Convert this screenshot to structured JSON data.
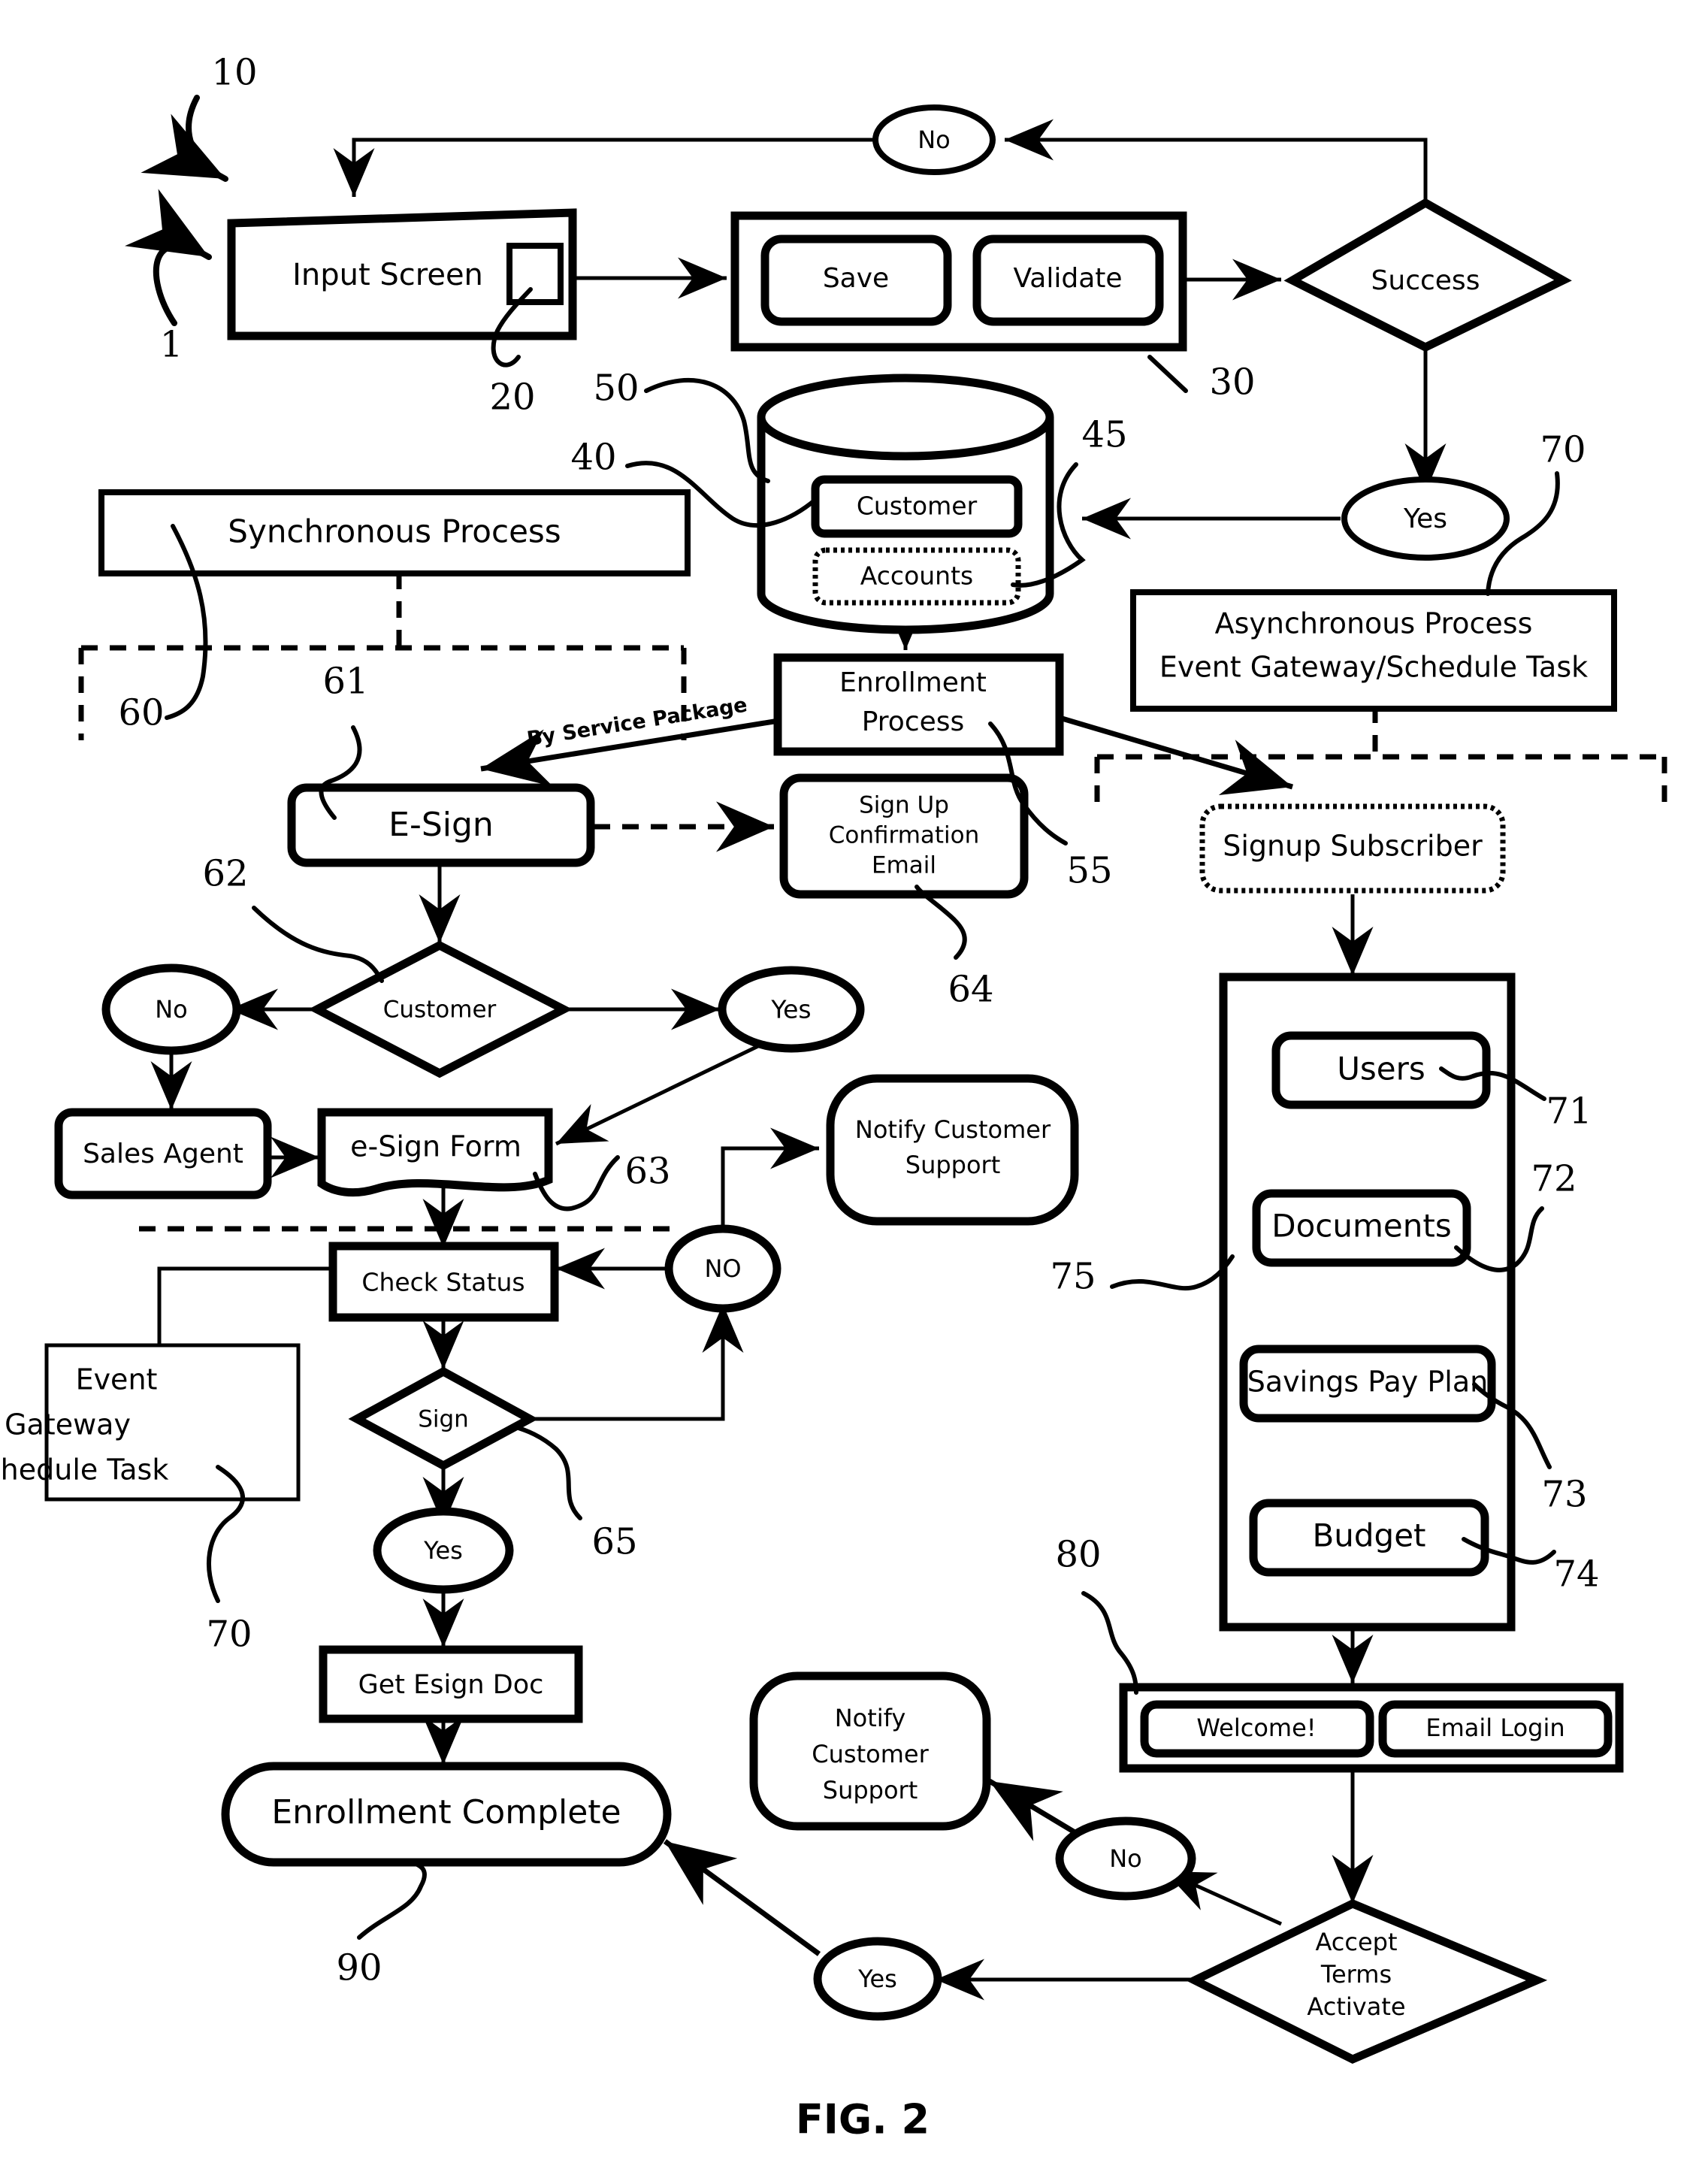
{
  "figure": {
    "caption": "FIG. 2"
  },
  "nodes": {
    "input_screen": "Input Screen",
    "save": "Save",
    "validate": "Validate",
    "success": "Success",
    "no_top": "No",
    "yes_top": "Yes",
    "synchronous_process": "Synchronous Process",
    "customer_store": "Customer",
    "accounts_store": "Accounts",
    "async_process_line1": "Asynchronous Process",
    "async_process_line2": "Event Gateway/Schedule Task",
    "enrollment_process_line1": "Enrollment",
    "enrollment_process_line2": "Process",
    "esign": "E-Sign",
    "signup_confirmation_line1": "Sign Up",
    "signup_confirmation_line2": "Confirmation",
    "signup_confirmation_line3": "Email",
    "signup_subscriber": "Signup Subscriber",
    "customer_decision": "Customer",
    "no_customer": "No",
    "yes_customer": "Yes",
    "sales_agent": "Sales Agent",
    "esign_form": "e-Sign Form",
    "notify_support_mid_line1": "Notify Customer",
    "notify_support_mid_line2": "Support",
    "no_check": "NO",
    "check_status": "Check Status",
    "event_gateway_line1": "Event",
    "event_gateway_line2": "Gateway",
    "event_gateway_line3": "Schedule Task",
    "sign_decision": "Sign",
    "yes_sign": "Yes",
    "get_esign_doc": "Get Esign Doc",
    "enrollment_complete": "Enrollment Complete",
    "users": "Users",
    "documents": "Documents",
    "savings_pay_plan": "Savings Pay Plan",
    "budget": "Budget",
    "welcome": "Welcome!",
    "email_login": "Email Login",
    "notify_support_bottom_line1": "Notify",
    "notify_support_bottom_line2": "Customer",
    "notify_support_bottom_line3": "Support",
    "no_accept": "No",
    "yes_accept": "Yes",
    "accept_terms_line1": "Accept",
    "accept_terms_line2": "Terms",
    "accept_terms_line3": "Activate"
  },
  "edge_labels": {
    "by_service_package": "By Service Package"
  },
  "reference_numerals": {
    "n10": "10",
    "n1": "1",
    "n20": "20",
    "n30": "30",
    "n40": "40",
    "n45": "45",
    "n50": "50",
    "n55": "55",
    "n60": "60",
    "n61": "61",
    "n62": "62",
    "n63": "63",
    "n64": "64",
    "n65": "65",
    "n70_right": "70",
    "n70_left": "70",
    "n71": "71",
    "n72": "72",
    "n73": "73",
    "n74": "74",
    "n75": "75",
    "n80": "80",
    "n90": "90"
  },
  "style": {
    "ink": "#000000",
    "paper": "#ffffff"
  }
}
